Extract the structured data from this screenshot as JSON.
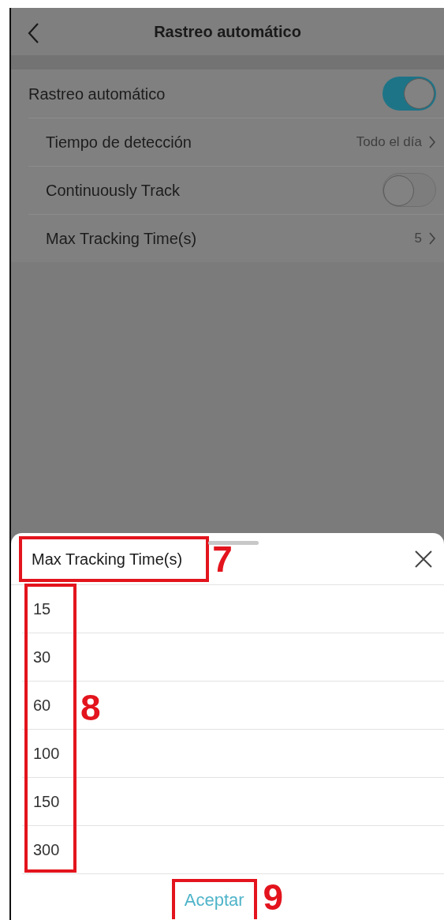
{
  "header": {
    "title": "Rastreo automático"
  },
  "settings": [
    {
      "label": "Rastreo automático",
      "kind": "toggle",
      "on": true,
      "children": [
        {
          "label": "Tiempo de detección",
          "kind": "link",
          "value": "Todo el día"
        },
        {
          "label": "Continuously Track",
          "kind": "toggle",
          "on": false
        },
        {
          "label": "Max Tracking Time(s)",
          "kind": "link",
          "value": "5"
        }
      ]
    }
  ],
  "sheet": {
    "title": "Max Tracking Time(s)",
    "options": [
      {
        "label": "15",
        "selected": false
      },
      {
        "label": "30",
        "selected": false
      },
      {
        "label": "60",
        "selected": false
      },
      {
        "label": "100",
        "selected": false
      },
      {
        "label": "150",
        "selected": false
      },
      {
        "label": "300",
        "selected": false
      }
    ],
    "confirm": "Aceptar"
  },
  "annotations": [
    {
      "label": "7",
      "kind": "title"
    },
    {
      "label": "8",
      "kind": "options"
    },
    {
      "label": "9",
      "kind": "confirm"
    }
  ]
}
